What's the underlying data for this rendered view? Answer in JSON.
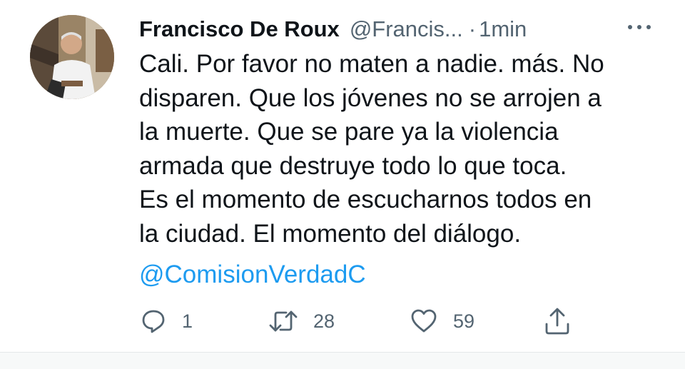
{
  "tweet": {
    "author_name": "Francisco De Roux",
    "handle": "@Francis...",
    "separator": "·",
    "time": "1min",
    "more_icon": "ellipsis-icon",
    "text_lines": [
      "Cali. Por favor no maten a nadie. más. No",
      "disparen. Que los jóvenes no se arrojen a",
      "la muerte. Que se pare ya la violencia",
      "armada que destruye todo lo que toca.",
      "Es el momento de escucharnos todos en",
      "la ciudad. El momento del diálogo."
    ],
    "mention": "@ComisionVerdadC",
    "actions": {
      "reply": {
        "icon": "reply-icon",
        "count": "1"
      },
      "retweet": {
        "icon": "retweet-icon",
        "count": "28"
      },
      "like": {
        "icon": "heart-icon",
        "count": "59"
      },
      "share": {
        "icon": "share-icon"
      }
    }
  },
  "colors": {
    "text": "#0f1419",
    "secondary": "#536471",
    "link": "#1d9bf0",
    "background": "#ffffff",
    "divider_band": "#f7f9f9"
  }
}
